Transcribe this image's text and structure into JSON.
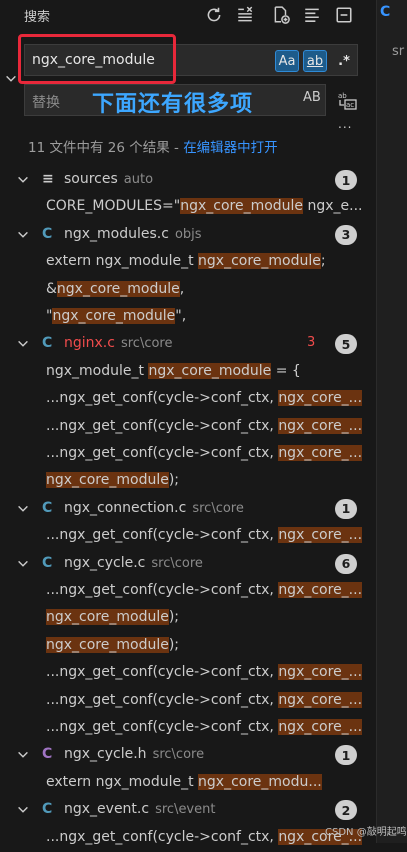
{
  "header": {
    "title": "搜索"
  },
  "toolbar": [
    {
      "name": "refresh-icon"
    },
    {
      "name": "clear-results-icon"
    },
    {
      "name": "new-search-editor-icon"
    },
    {
      "name": "view-as-tree-icon"
    },
    {
      "name": "collapse-all-icon"
    }
  ],
  "search": {
    "value": "ngx_core_module",
    "match_case_label": "Aa",
    "whole_word_label": "ab",
    "regex_label": ".*"
  },
  "replace": {
    "placeholder": "替换",
    "preserve_case_label": "AB",
    "more_label": "..."
  },
  "annotation": "下面还有很多项",
  "summary": {
    "text": "11 文件中有 26 个结果 - ",
    "link": "在编辑器中打开"
  },
  "files": [
    {
      "icon": "≡",
      "icon_color": "#cccccc",
      "name": "sources",
      "path": "auto",
      "count": "1",
      "error": "",
      "matches": [
        {
          "pre": "CORE_MODULES=\"",
          "hl": "ngx_core_module",
          "post": " ngx_e..."
        }
      ]
    },
    {
      "icon": "C",
      "icon_color": "#519aba",
      "name": "ngx_modules.c",
      "path": "objs",
      "count": "3",
      "error": "",
      "matches": [
        {
          "pre": "extern ngx_module_t  ",
          "hl": "ngx_core_module",
          "post": ";"
        },
        {
          "pre": "&",
          "hl": "ngx_core_module",
          "post": ","
        },
        {
          "pre": "\"",
          "hl": "ngx_core_module",
          "post": "\","
        }
      ]
    },
    {
      "icon": "C",
      "icon_color": "#519aba",
      "name": "nginx.c",
      "path": "src\\core",
      "count": "5",
      "error": "3",
      "name_color": "#f14c4c",
      "matches": [
        {
          "pre": "ngx_module_t  ",
          "hl": "ngx_core_module",
          "post": " = {"
        },
        {
          "pre": "...ngx_get_conf(cycle->conf_ctx, ",
          "hl": "ngx_core_...",
          "post": ""
        },
        {
          "pre": "...ngx_get_conf(cycle->conf_ctx, ",
          "hl": "ngx_core_...",
          "post": ""
        },
        {
          "pre": "...ngx_get_conf(cycle->conf_ctx, ",
          "hl": "ngx_core_...",
          "post": ""
        },
        {
          "pre": "",
          "hl": "ngx_core_module",
          "post": ");"
        }
      ]
    },
    {
      "icon": "C",
      "icon_color": "#519aba",
      "name": "ngx_connection.c",
      "path": "src\\core",
      "count": "1",
      "error": "",
      "matches": [
        {
          "pre": "...ngx_get_conf(cycle->conf_ctx, ",
          "hl": "ngx_core_...",
          "post": ""
        }
      ]
    },
    {
      "icon": "C",
      "icon_color": "#519aba",
      "name": "ngx_cycle.c",
      "path": "src\\core",
      "count": "6",
      "error": "",
      "matches": [
        {
          "pre": "...ngx_get_conf(cycle->conf_ctx, ",
          "hl": "ngx_core_...",
          "post": ""
        },
        {
          "pre": "",
          "hl": "ngx_core_module",
          "post": ");"
        },
        {
          "pre": "",
          "hl": "ngx_core_module",
          "post": ");"
        },
        {
          "pre": "...ngx_get_conf(cycle->conf_ctx, ",
          "hl": "ngx_core_...",
          "post": ""
        },
        {
          "pre": "...ngx_get_conf(cycle->conf_ctx, ",
          "hl": "ngx_core_...",
          "post": ""
        },
        {
          "pre": "...ngx_get_conf(cycle->conf_ctx, ",
          "hl": "ngx_core_...",
          "post": ""
        }
      ]
    },
    {
      "icon": "C",
      "icon_color": "#a074c4",
      "name": "ngx_cycle.h",
      "path": "src\\core",
      "count": "1",
      "error": "",
      "matches": [
        {
          "pre": "extern ngx_module_t            ",
          "hl": "ngx_core_modu...",
          "post": ""
        }
      ]
    },
    {
      "icon": "C",
      "icon_color": "#519aba",
      "name": "ngx_event.c",
      "path": "src\\event",
      "count": "2",
      "error": "",
      "matches": [
        {
          "pre": "...ngx_get_conf(cycle->conf_ctx, ",
          "hl": "ngx_core_...",
          "post": ""
        }
      ]
    }
  ],
  "right_panel": {
    "tab": "C",
    "text": "sr"
  },
  "watermark": "CSDN @敲明起鸣"
}
